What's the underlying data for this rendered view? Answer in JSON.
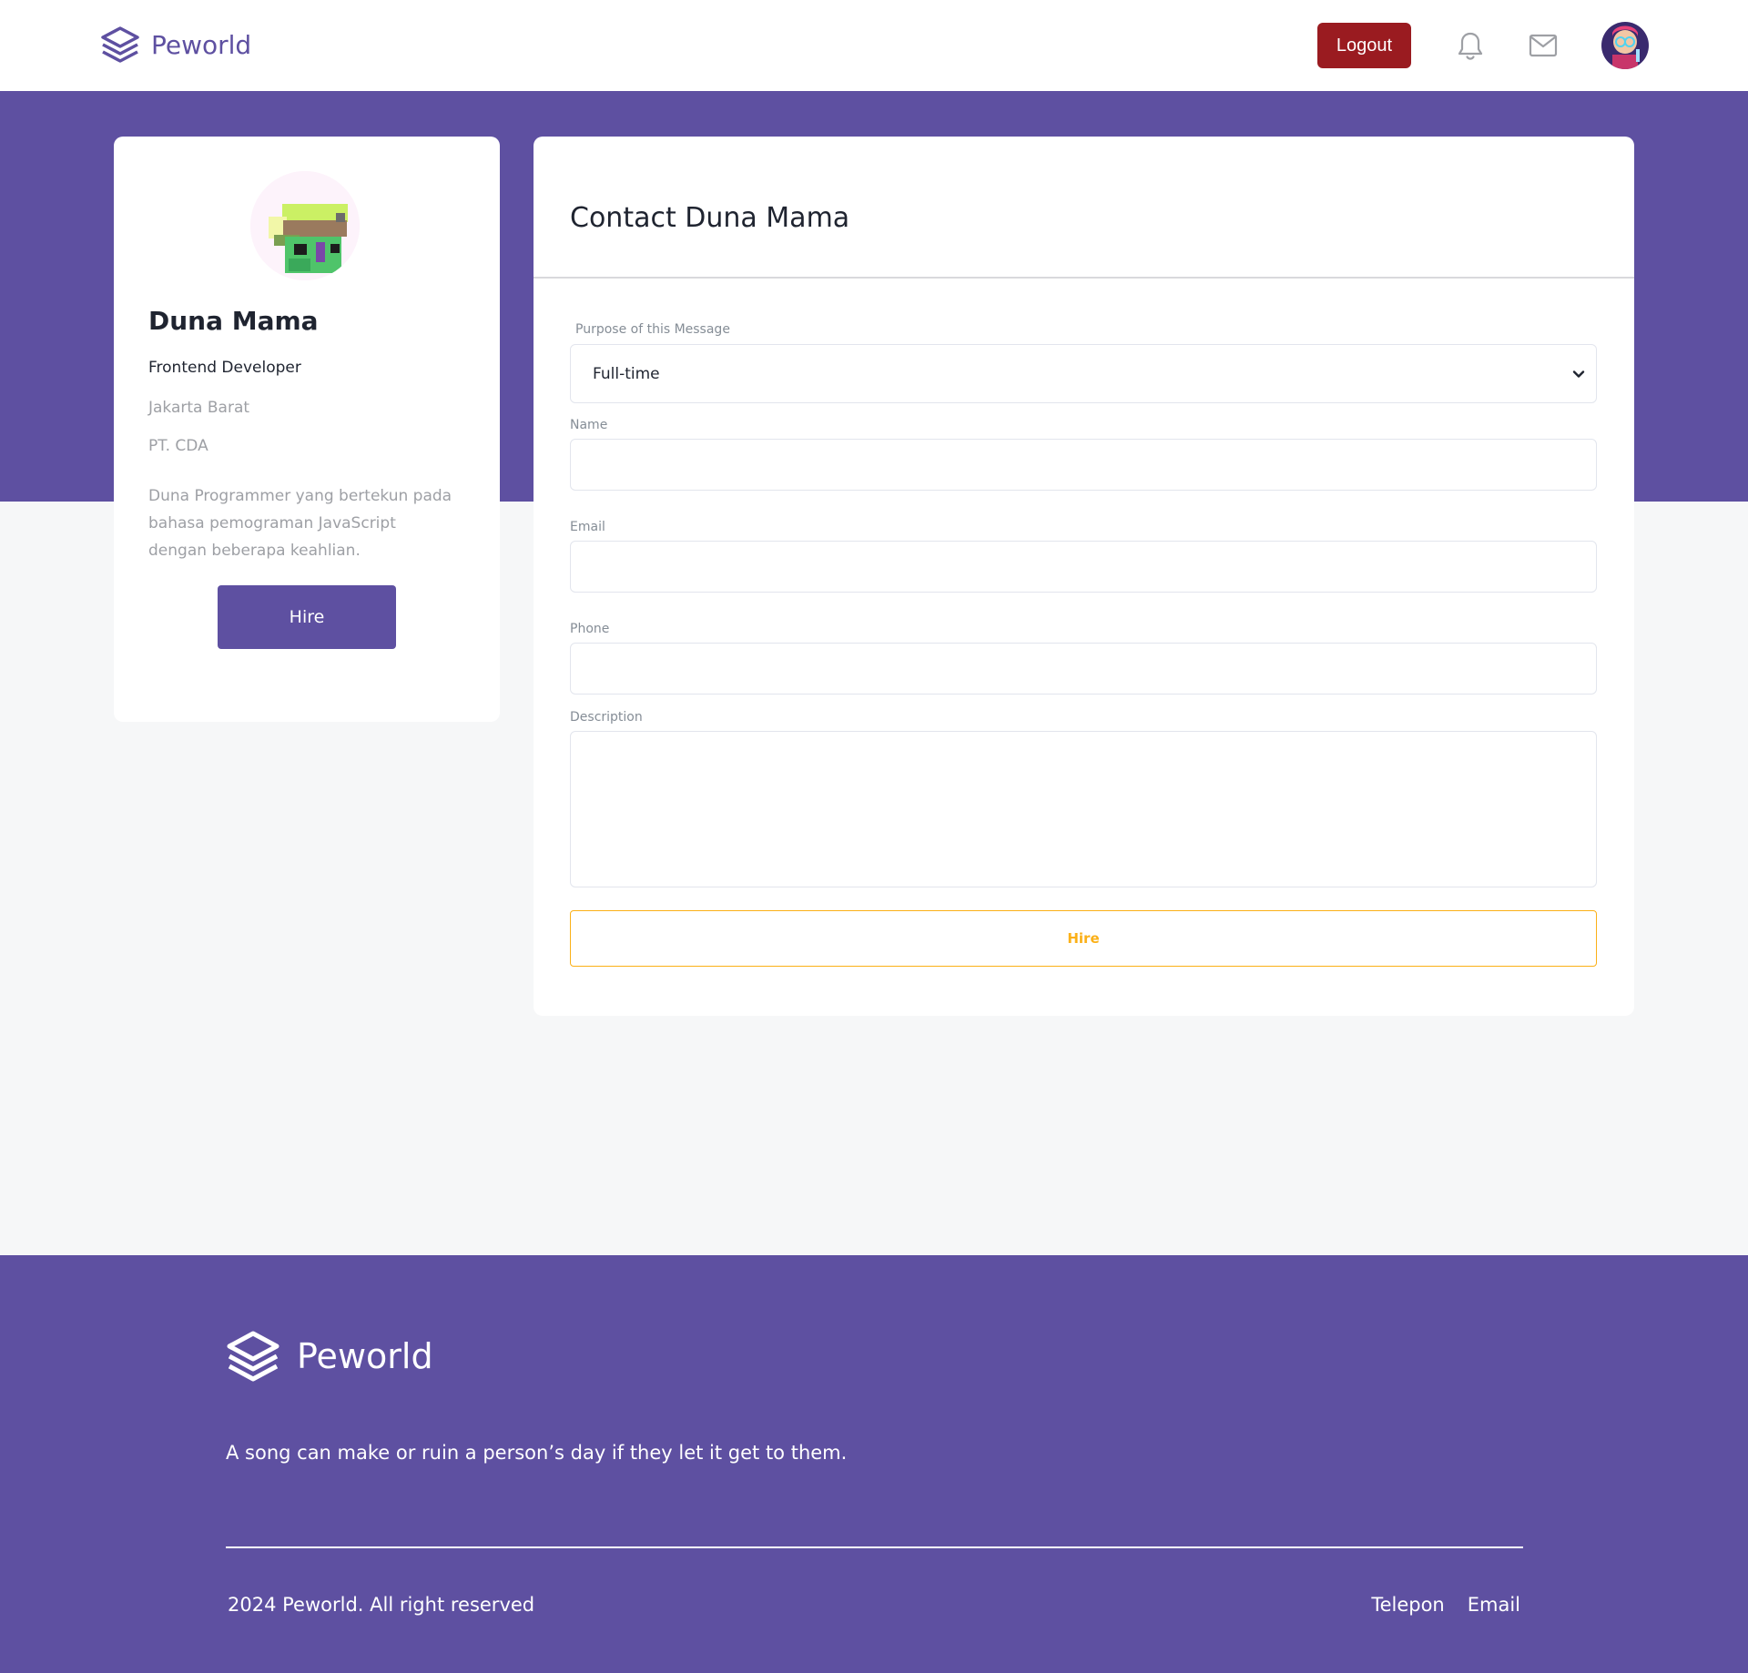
{
  "header": {
    "brand": "Peworld",
    "logout_label": "Logout",
    "bell_icon": "bell-icon",
    "mail_icon": "mail-icon"
  },
  "profile": {
    "name": "Duna Mama",
    "role": "Frontend Developer",
    "location": "Jakarta Barat",
    "company": "PT. CDA",
    "description": "Duna Programmer yang bertekun pada bahasa pemograman JavaScript dengan beberapa keahlian.",
    "hire_label": "Hire"
  },
  "contact": {
    "title": "Contact Duna Mama",
    "purpose_label": "Purpose of this Message",
    "purpose_value": "Full-time",
    "name_label": "Name",
    "name_value": "",
    "email_label": "Email",
    "email_value": "",
    "phone_label": "Phone",
    "phone_value": "",
    "description_label": "Description",
    "description_value": "",
    "submit_label": "Hire"
  },
  "footer": {
    "brand": "Peworld",
    "tagline": "A song can make or ruin a person’s day if they let it get to them.",
    "copyright": "2024 Peworld. All right reserved",
    "links": [
      "Telepon",
      "Email"
    ]
  },
  "colors": {
    "primary": "#5e50a1",
    "logout": "#9a1b20",
    "accent": "#fbb017",
    "background": "#f6f7f8"
  }
}
